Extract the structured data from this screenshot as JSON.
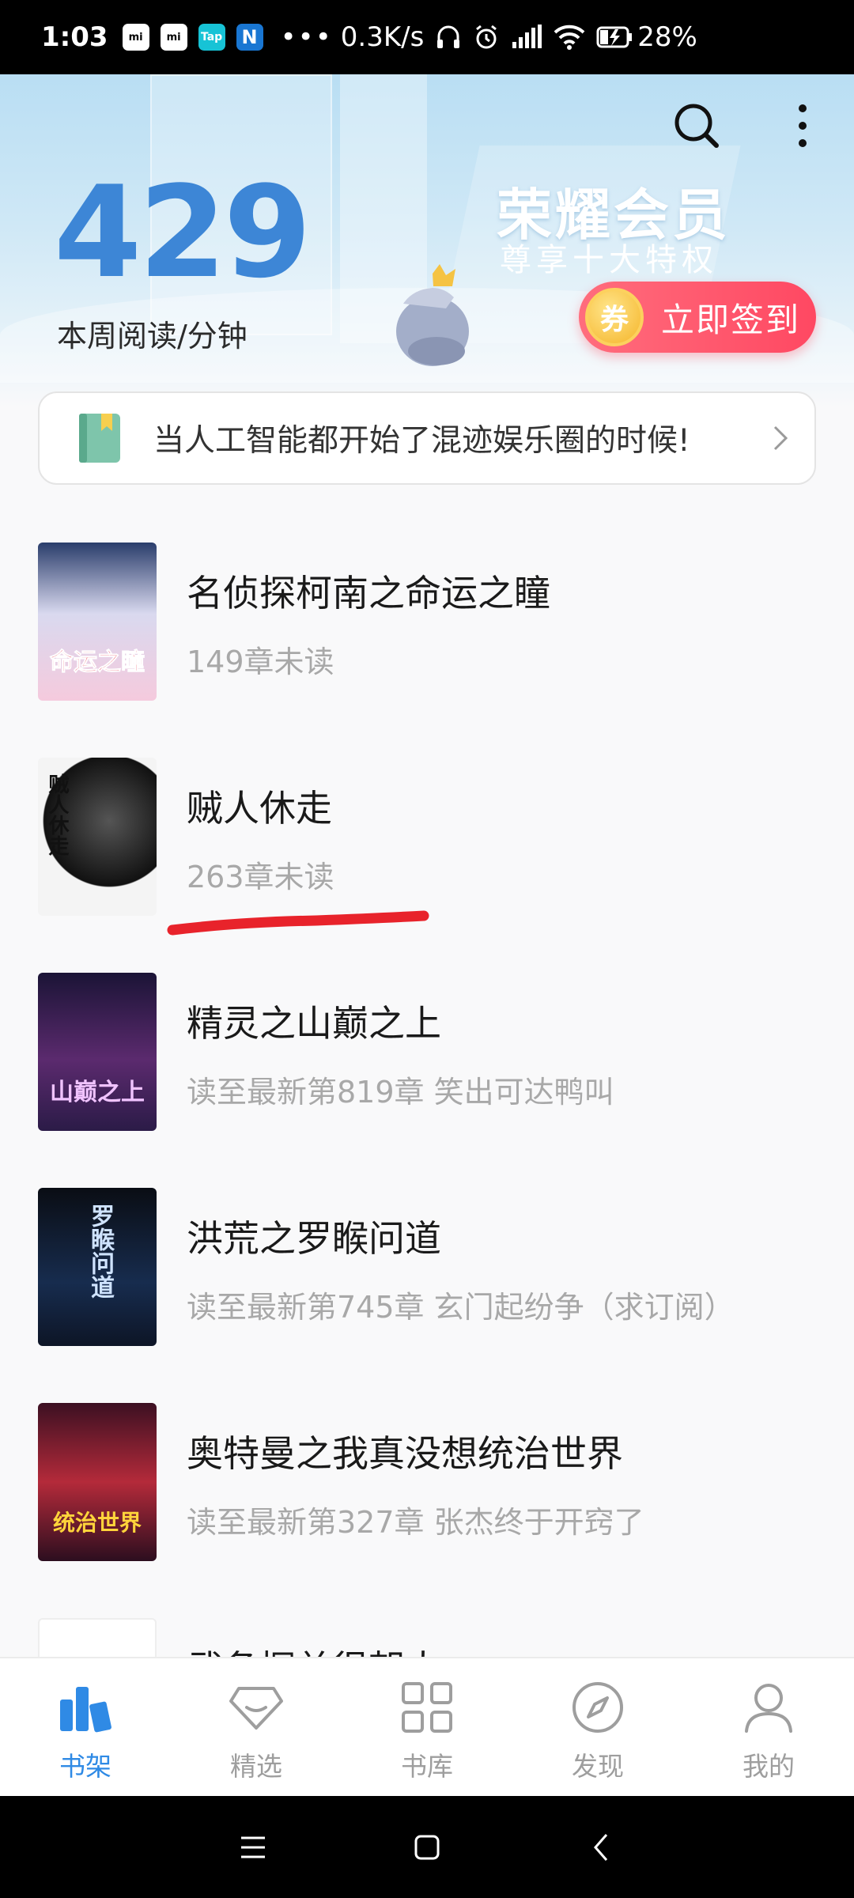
{
  "status_bar": {
    "time": "1:03",
    "app_icons": [
      "mi",
      "mi",
      "Tap",
      "N"
    ],
    "dots": "•••",
    "net_speed": "0.3K/s",
    "battery": "28%"
  },
  "header": {
    "reading_minutes": "429",
    "reading_label": "本周阅读/分钟",
    "vip_title": "荣耀会员",
    "vip_subtitle": "尊享十大特权",
    "signin_coupon": "券",
    "signin_label": "立即签到"
  },
  "notice": {
    "text": "当人工智能都开始了混迹娱乐圈的时候!"
  },
  "books": [
    {
      "title": "名侦探柯南之命运之瞳",
      "progress": "149章未读",
      "cover_text": "命运之瞳"
    },
    {
      "title": "贼人休走",
      "progress": "263章未读",
      "cover_text": "贼人休走"
    },
    {
      "title": "精灵之山巅之上",
      "progress": "读至最新第819章 笑出可达鸭叫",
      "cover_text": "山巅之上"
    },
    {
      "title": "洪荒之罗睺问道",
      "progress": "读至最新第745章 玄门起纷争（求订阅）",
      "cover_text": "罗睺问道"
    },
    {
      "title": "奥特曼之我真没想统治世界",
      "progress": "读至最新第327章 张杰终于开窍了",
      "cover_text": "统治世界"
    },
    {
      "title": "武备探单很朝大",
      "progress": "",
      "cover_text": ""
    }
  ],
  "bottom_nav": [
    {
      "label": "书架",
      "icon": "bookshelf-icon",
      "active": true
    },
    {
      "label": "精选",
      "icon": "diamond-icon",
      "active": false
    },
    {
      "label": "书库",
      "icon": "grid-icon",
      "active": false
    },
    {
      "label": "发现",
      "icon": "compass-icon",
      "active": false
    },
    {
      "label": "我的",
      "icon": "user-icon",
      "active": false
    }
  ],
  "colors": {
    "accent_blue": "#2f8ae5",
    "minutes_blue": "#3d86d6",
    "signin_red": "#ff4862",
    "annotation_red": "#e8232b"
  }
}
